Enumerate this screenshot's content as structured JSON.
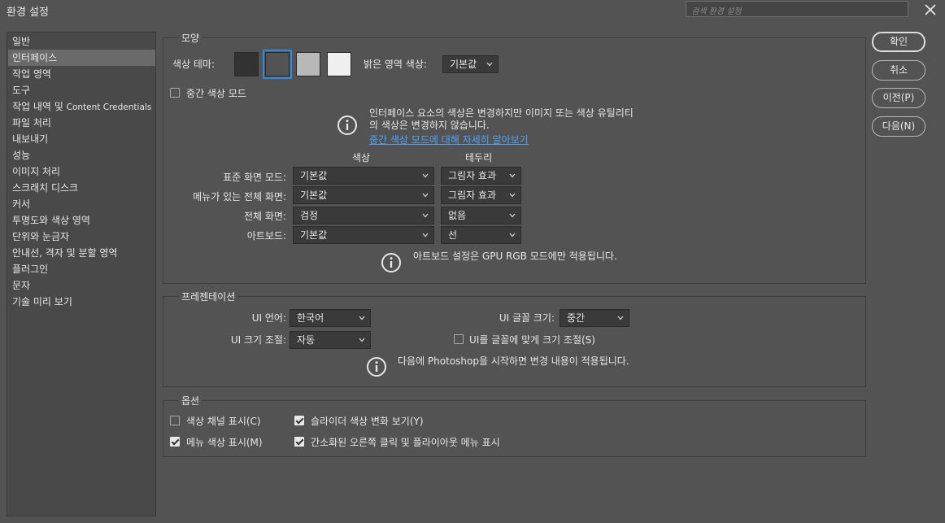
{
  "window": {
    "title": "환경 설정",
    "search_placeholder": "검색 환경 설정"
  },
  "sidebar": {
    "items": [
      {
        "label": "일반"
      },
      {
        "label": "인터페이스",
        "active": true
      },
      {
        "label": "작업 영역"
      },
      {
        "label": "도구"
      },
      {
        "label": "작업 내역 및 ",
        "label_small": "Content Credentials"
      },
      {
        "label": "파일 처리"
      },
      {
        "label": "내보내기"
      },
      {
        "label": "성능"
      },
      {
        "label": "이미지 처리"
      },
      {
        "label": "스크래치 디스크"
      },
      {
        "label": "커서"
      },
      {
        "label": "투명도와 색상 영역"
      },
      {
        "label": "단위와 눈금자"
      },
      {
        "label": "안내선, 격자 및 분할 영역"
      },
      {
        "label": "플러그인"
      },
      {
        "label": "문자"
      },
      {
        "label": "기술 미리 보기"
      }
    ]
  },
  "appearance": {
    "legend": "모양",
    "color_theme_label": "색상 테마:",
    "themes": [
      {
        "color": "#323232"
      },
      {
        "color": "#535353",
        "selected": true
      },
      {
        "color": "#b8b8b8"
      },
      {
        "color": "#f0f0f0"
      }
    ],
    "highlight_label": "밝은 영역 색상:",
    "highlight_value": "기본값",
    "mid_mode_label": "중간 색상 모드",
    "mid_mode_checked": false,
    "info_line1": "인터페이스 요소의 색상은 변경하지만 이미지 또는 색상 유틸리티",
    "info_line2": "의 색상은 변경하지 않습니다.",
    "info_link": "중간 색상 모드에 대해 자세히 알아보기",
    "col_color": "색상",
    "col_border": "테두리",
    "rows": [
      {
        "label": "표준 화면 모드:",
        "color": "기본값",
        "border": "그림자 효과"
      },
      {
        "label": "메뉴가 있는 전체 화면:",
        "color": "기본값",
        "border": "그림자 효과"
      },
      {
        "label": "전체 화면:",
        "color": "검정",
        "border": "없음"
      },
      {
        "label": "아트보드:",
        "color": "기본값",
        "border": "선"
      }
    ],
    "artboard_note": "아트보드 설정은 GPU RGB 모드에만 적용됩니다."
  },
  "presentation": {
    "legend": "프레젠테이션",
    "ui_language_label": "UI 언어:",
    "ui_language_value": "한국어",
    "ui_font_size_label": "UI 글꼴 크기:",
    "ui_font_size_value": "중간",
    "ui_scale_label": "UI 크기 조절:",
    "ui_scale_value": "자동",
    "scale_to_font_label": "UI를 글꼴에 맞게 크기 조절(S)",
    "scale_to_font_checked": false,
    "restart_note": "다음에 Photoshop을 시작하면 변경 내용이 적용됩니다."
  },
  "options": {
    "legend": "옵션",
    "items": [
      {
        "label": "색상 채널 표시(C)",
        "checked": false
      },
      {
        "label": "슬라이더 색상 변화 보기(Y)",
        "checked": true
      },
      {
        "label": "메뉴 색상 표시(M)",
        "checked": true
      },
      {
        "label": "간소화된 오른쪽 클릭 및 플라이아웃 메뉴 표시",
        "checked": true
      }
    ]
  },
  "buttons": {
    "ok": "확인",
    "cancel": "취소",
    "prev": "이전(P)",
    "next": "다음(N)"
  },
  "colors": {
    "background": "#535353",
    "accent": "#2e8ae6",
    "link": "#4fa3f7"
  }
}
